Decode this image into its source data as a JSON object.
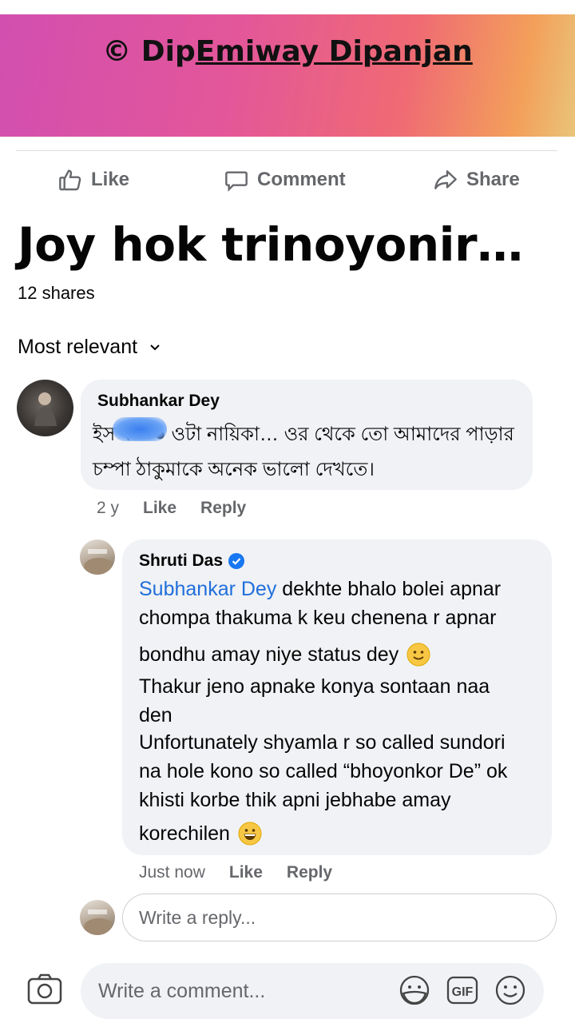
{
  "banner": {
    "copyright": "©",
    "text_plain": "Dip",
    "text_underlined": "Emiway Dipanjan"
  },
  "actions": {
    "like": "Like",
    "comment": "Comment",
    "share": "Share"
  },
  "post": {
    "title": "Joy hok trinoyonir…",
    "shares": "12 shares"
  },
  "sort": {
    "label": "Most relevant"
  },
  "comments": [
    {
      "author": "Subhankar Dey",
      "lines": [
        "ইস ব●●● ওটা নায়িকা… ওর থেকে তো আমাদের পাড়ার",
        "চম্পা ঠাকুমাকে অনেক ভালো দেখতে।"
      ],
      "time": "2 y",
      "like": "Like",
      "reply": "Reply"
    },
    {
      "author": "Shruti Das",
      "mention": "Subhankar Dey",
      "line1_rest": " dekhte bhalo bolei apnar",
      "line2": "chompa thakuma k keu chenena r apnar",
      "line3": "bondhu amay niye status dey",
      "line4": "Thakur jeno apnake konya sontaan naa",
      "line5": "den",
      "line6": "Unfortunately shyamla r so called sundori",
      "line7": "na hole kono so called “bhoyonkor De” ok",
      "line8": "khisti korbe thik apni jebhabe amay",
      "line9": "korechilen",
      "time": "Just now",
      "like": "Like",
      "reply": "Reply"
    }
  ],
  "reply_input": {
    "placeholder": "Write a reply..."
  },
  "comment_input": {
    "placeholder": "Write a comment..."
  },
  "icons": {
    "sticker": "sticker-icon",
    "gif": "GIF",
    "emoji": "emoji-icon"
  },
  "colors": {
    "mention": "#216fdb",
    "verified": "#1877f2",
    "bubble": "#f0f2f5",
    "meta": "#65676b"
  }
}
